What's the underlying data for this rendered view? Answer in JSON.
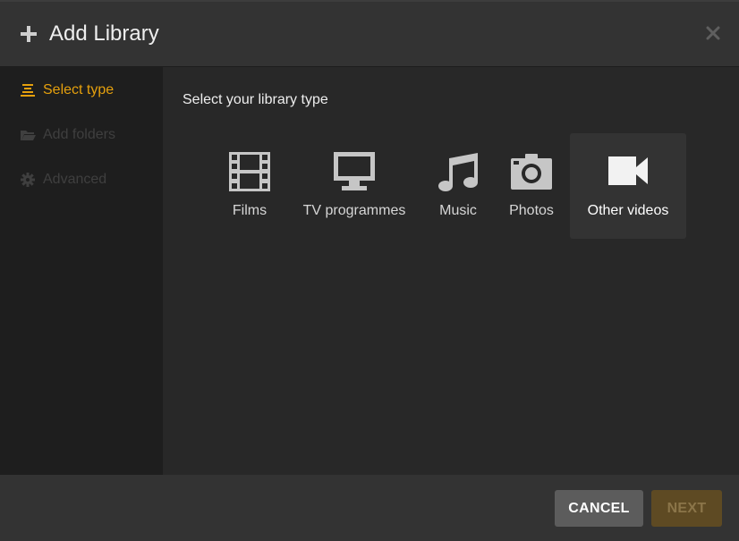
{
  "header": {
    "title": "Add Library"
  },
  "sidebar": {
    "items": [
      {
        "label": "Select type",
        "state": "active",
        "icon": "list-icon"
      },
      {
        "label": "Add folders",
        "state": "disabled",
        "icon": "folder-icon"
      },
      {
        "label": "Advanced",
        "state": "disabled",
        "icon": "gear-icon"
      }
    ]
  },
  "main": {
    "prompt": "Select your library type",
    "types": [
      {
        "label": "Films",
        "icon": "film-icon",
        "selected": false
      },
      {
        "label": "TV programmes",
        "icon": "tv-icon",
        "selected": false
      },
      {
        "label": "Music",
        "icon": "music-icon",
        "selected": false
      },
      {
        "label": "Photos",
        "icon": "camera-icon",
        "selected": false
      },
      {
        "label": "Other videos",
        "icon": "video-camera-icon",
        "selected": true
      }
    ]
  },
  "footer": {
    "cancel_label": "CANCEL",
    "next_label": "NEXT"
  },
  "colors": {
    "accent": "#e5a00d",
    "background": "#282828",
    "sidebar": "#1e1e1e"
  }
}
